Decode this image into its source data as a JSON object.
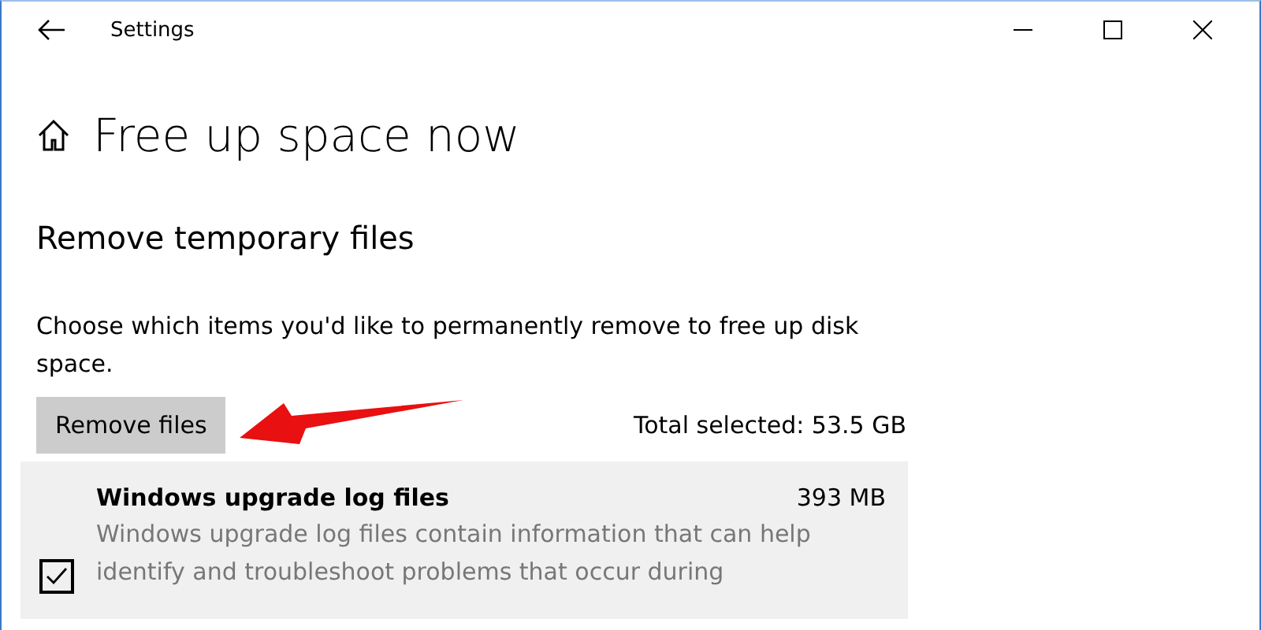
{
  "window": {
    "title": "Settings"
  },
  "page": {
    "title": "Free up space now"
  },
  "section": {
    "title": "Remove temporary files",
    "description": "Choose which items you'd like to permanently remove to free up disk space.",
    "button": "Remove files",
    "total": "Total selected: 53.5 GB"
  },
  "items": [
    {
      "name": "Windows upgrade log files",
      "size": "393 MB",
      "description": "Windows upgrade log files contain information that can help identify and troubleshoot problems that occur during",
      "checked": true
    }
  ]
}
